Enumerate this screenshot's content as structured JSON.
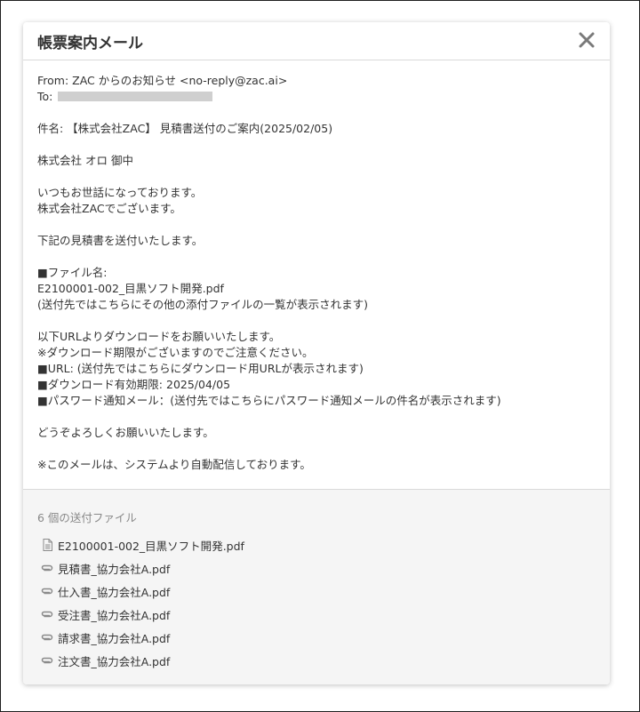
{
  "modal": {
    "title": "帳票案内メール",
    "close_symbol": "✕"
  },
  "mail": {
    "from": "From: ZAC からのお知らせ <no-reply@zac.ai>",
    "to_label": "To: ",
    "subject": "件名: 【株式会社ZAC】 見積書送付のご案内(2025/02/05)",
    "recipient": "株式会社 オロ 御中",
    "greeting_1": "いつもお世話になっております。",
    "greeting_2": "株式会社ZACでございます。",
    "intro": "下記の見積書を送付いたします。",
    "file_label": "■ファイル名:",
    "file_name": "E2100001-002_目黒ソフト開発.pdf",
    "file_note": "(送付先ではこちらにその他の添付ファイルの一覧が表示されます)",
    "download_request": "以下URLよりダウンロードをお願いいたします。",
    "download_notice": "※ダウンロード期限がございますのでご注意ください。",
    "url_line": "■URL: (送付先ではこちらにダウンロード用URLが表示されます)",
    "expiry_line": "■ダウンロード有効期限: 2025/04/05",
    "password_line": "■パスワード通知メール：(送付先ではこちらにパスワード通知メールの件名が表示されます)",
    "closing": "どうぞよろしくお願いいたします。",
    "auto_notice": "※このメールは、システムより自動配信しております。"
  },
  "attachments": {
    "title": "6 個の送付ファイル",
    "items": [
      {
        "name": "E2100001-002_目黒ソフト開発.pdf",
        "icon": "document-icon"
      },
      {
        "name": "見積書_協力会社A.pdf",
        "icon": "paperclip-icon"
      },
      {
        "name": "仕入書_協力会社A.pdf",
        "icon": "paperclip-icon"
      },
      {
        "name": "受注書_協力会社A.pdf",
        "icon": "paperclip-icon"
      },
      {
        "name": "請求書_協力会社A.pdf",
        "icon": "paperclip-icon"
      },
      {
        "name": "注文書_協力会社A.pdf",
        "icon": "paperclip-icon"
      }
    ]
  },
  "colors": {
    "border": "#d9d9d9",
    "attach_bg": "#f5f5f5",
    "muted_text": "#888888",
    "icon_gray": "#8a8a8a"
  }
}
